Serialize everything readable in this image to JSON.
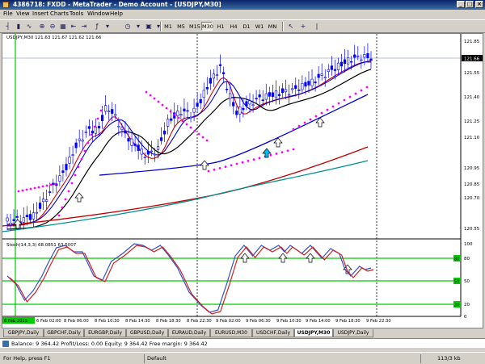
{
  "window": {
    "title": "4386718: FXDD - MetaTrader - Demo Account - [USDJPY,M30]"
  },
  "menu": [
    "File",
    "View",
    "Insert",
    "Charts",
    "Tools",
    "Window",
    "Help"
  ],
  "toolbar": {
    "timeframes": [
      "M1",
      "M5",
      "M15",
      "M30",
      "H1",
      "H4",
      "D1",
      "W1",
      "MN"
    ],
    "active_timeframe": "M30"
  },
  "chart": {
    "main_legend": "USDJPY,M30  121.63 121.67 121.62 121.66",
    "stoch_legend": "Stoch(14,3,3) 68.0851 63.5007",
    "price_labels": [
      "121.85",
      "121.55",
      "121.40",
      "121.25",
      "121.10",
      "120.95",
      "120.85",
      "120.70",
      "120.55"
    ],
    "current_price": "121.66",
    "stoch_levels": [
      "100",
      "80",
      "50",
      "20",
      "0"
    ],
    "stoch_level_labels": [
      "80",
      "50",
      "20"
    ],
    "time_labels": [
      "6 Feb 2015",
      "6 Feb 02:00",
      "8 Feb 06:00",
      "8 Feb 10:30",
      "8 Feb 14:30",
      "8 Feb 18:30",
      "8 Feb 22:30",
      "9 Feb 02:00",
      "9 Feb 06:30",
      "9 Feb 10:30",
      "9 Feb 14:00",
      "9 Feb 18:30",
      "9 Feb 22:30"
    ],
    "colors": {
      "candle": "#0000ff",
      "ma_fast": "#d00000",
      "ma_black": "#000000",
      "ma_blue": "#0000cc",
      "ma_red_slow": "#c00000",
      "ma_teal": "#009090",
      "sar": "#ff00ff",
      "level_line": "#00cc00",
      "arrow_up": "#00bfff"
    }
  },
  "tabs": [
    "GBPJPY,Daily",
    "GBPCHF,Daily",
    "EURGBP,Daily",
    "GBPUSD,Daily",
    "EURAUD,Daily",
    "EURUSD,M30",
    "USDCHF,Daily",
    "USDJPY,M30",
    "USDJPY,Daily"
  ],
  "active_tab": "USDJPY,M30",
  "account": {
    "text": "Balance: 9 364.42  Profit/Loss: 0.00  Equity: 9 364.42  Free margin: 9 364.42"
  },
  "status": {
    "help": "For Help, press F1",
    "profile": "Default",
    "traffic": "113/3 kb"
  }
}
